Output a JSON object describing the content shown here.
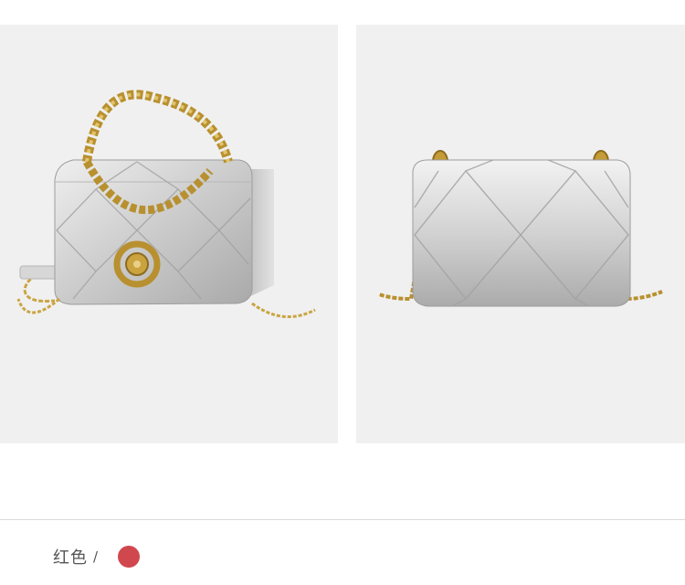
{
  "product_images": [
    {
      "view": "angled",
      "icon": "silver-quilted-chain-bag-angled"
    },
    {
      "view": "front",
      "icon": "silver-quilted-chain-bag-front"
    }
  ],
  "color_option": {
    "name": "红色",
    "separator": "/",
    "swatch_color": "#d0484e"
  },
  "colors": {
    "panel_bg": "#f0f0f0",
    "bag_silver": "#c8c8c8",
    "chain_gold": "#b8902f"
  }
}
